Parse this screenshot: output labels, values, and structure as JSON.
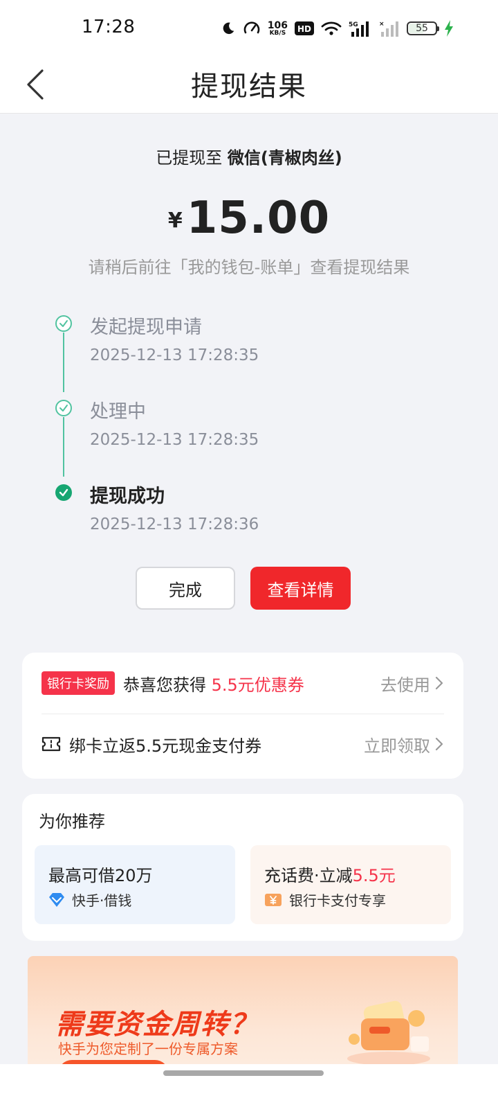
{
  "status_bar": {
    "time": "17:28",
    "net_speed_value": "106",
    "net_speed_unit": "KB/S",
    "hd_label": "HD",
    "network": "5G",
    "battery": "55"
  },
  "nav": {
    "title": "提现结果"
  },
  "result": {
    "dest_prefix": "已提现至",
    "dest_account": "微信(青椒肉丝)",
    "currency": "¥",
    "amount": "15.00",
    "hint": "请稍后前往「我的钱包-账单」查看提现结果"
  },
  "timeline": [
    {
      "title": "发起提现申请",
      "time": "2025-12-13 17:28:35",
      "state": "done"
    },
    {
      "title": "处理中",
      "time": "2025-12-13 17:28:35",
      "state": "done"
    },
    {
      "title": "提现成功",
      "time": "2025-12-13 17:28:36",
      "state": "final"
    }
  ],
  "buttons": {
    "done_label": "完成",
    "detail_label": "查看详情"
  },
  "reward_card": {
    "badge": "银行卡奖励",
    "text_prefix": "恭喜您获得",
    "text_highlight": "5.5元优惠券",
    "action": "去使用",
    "coupon_text": "绑卡立返5.5元现金支付券",
    "coupon_action": "立即领取"
  },
  "recommend": {
    "title": "为你推荐",
    "items": [
      {
        "head": "最高可借20万",
        "head_highlight": "",
        "sub": "快手·借钱"
      },
      {
        "head": "充话费·立减",
        "head_highlight": "5.5元",
        "sub": "银行卡支付专享"
      }
    ]
  },
  "banner": {
    "title": "需要资金周转？",
    "subtitle": "快手为您定制了一份专属方案"
  },
  "colors": {
    "accent_red": "#f0272b",
    "success_green": "#17a672",
    "timeline_green": "#51c3a0",
    "highlight_pink": "#f5334a"
  }
}
